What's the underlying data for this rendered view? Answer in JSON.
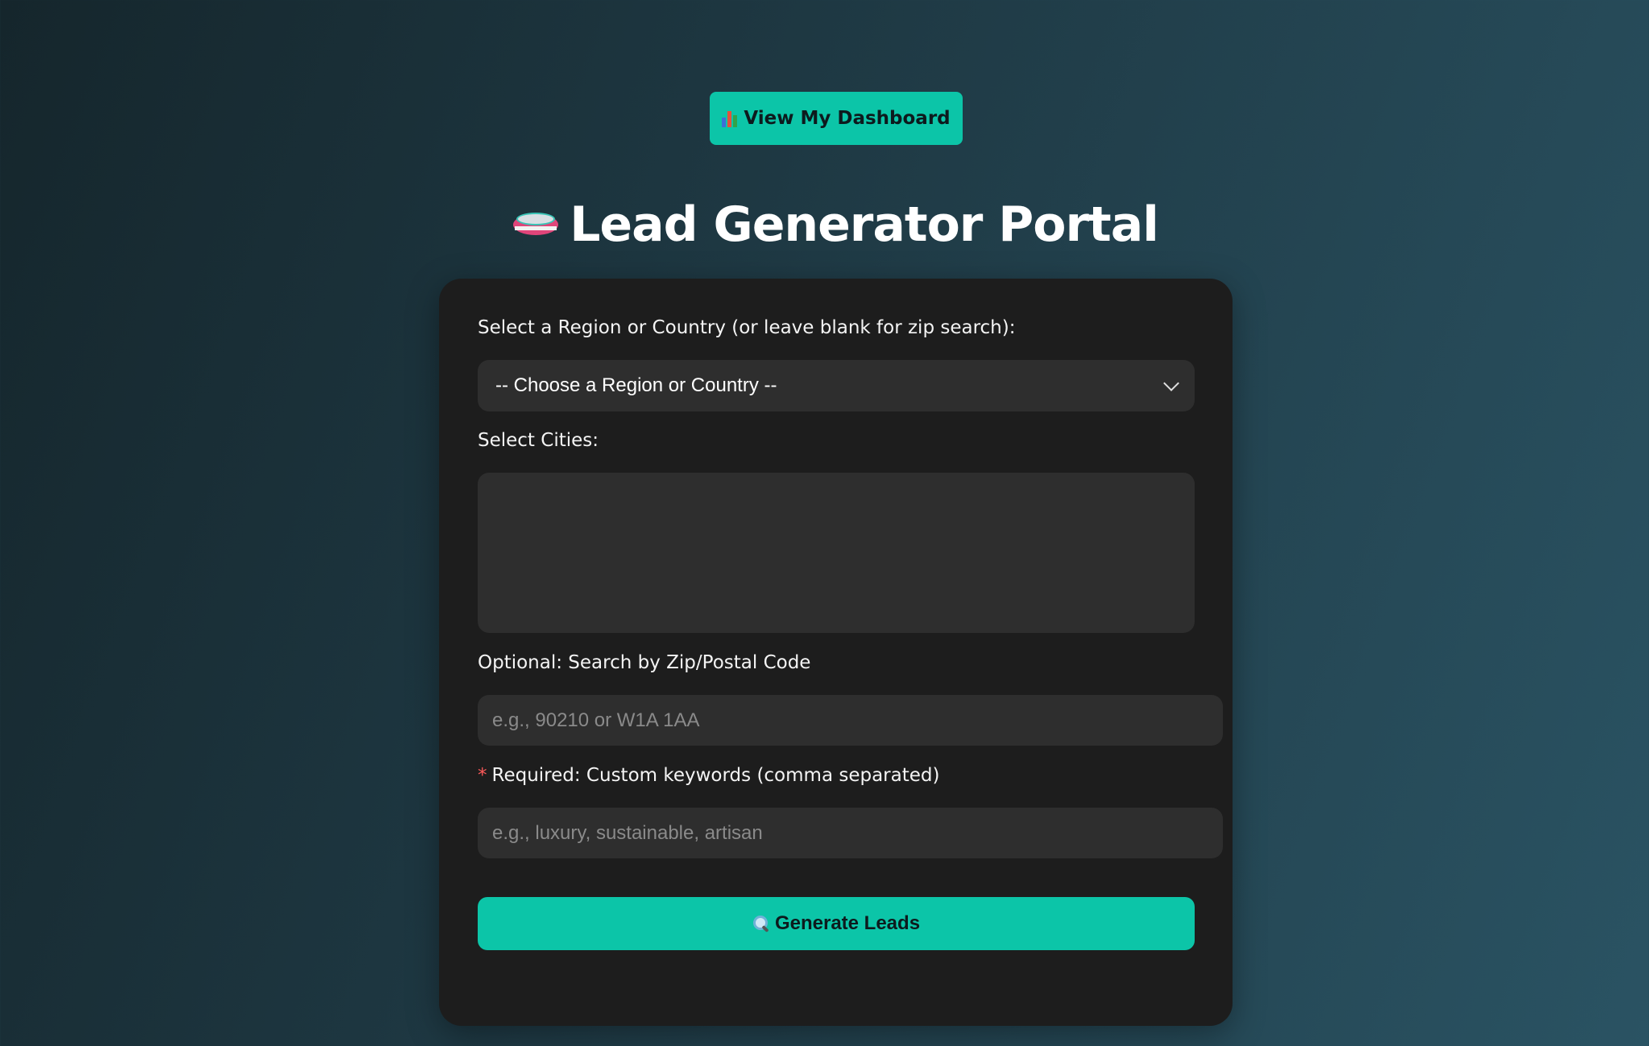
{
  "header": {
    "dashboard_button_label": "View My Dashboard",
    "dashboard_icon": "bar-chart-icon",
    "title": "Lead Generator Portal",
    "title_icon": "disk-icon"
  },
  "form": {
    "region_label": "Select a Region or Country (or leave blank for zip search):",
    "region_selected": "-- Choose a Region or Country --",
    "cities_label": "Select Cities:",
    "zip_label": "Optional: Search by Zip/Postal Code",
    "zip_placeholder": "e.g., 90210 or W1A 1AA",
    "keywords_required_marker": "*",
    "keywords_label": "Required: Custom keywords (comma separated)",
    "keywords_placeholder": "e.g., luxury, sustainable, artisan",
    "generate_button_label": "Generate Leads",
    "generate_icon": "magnifier-icon"
  },
  "colors": {
    "accent": "#0cc5a8",
    "card_bg": "#1d1d1d",
    "field_bg": "#2e2e2e",
    "required": "#ff5a5a"
  }
}
